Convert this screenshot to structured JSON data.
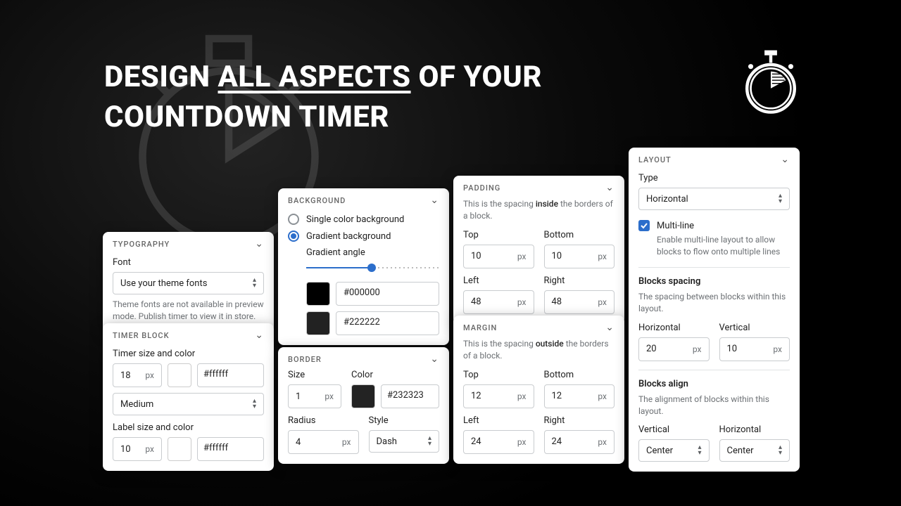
{
  "headline": {
    "pre": "DESIGN ",
    "mid": "ALL ASPECTS",
    "post": " OF YOUR",
    "line2": "COUNTDOWN TIMER"
  },
  "typography": {
    "header": "TYPOGRAPHY",
    "font_label": "Font",
    "font_value": "Use your theme fonts",
    "font_hint": "Theme fonts are not available in preview mode. Publish timer to view it in store."
  },
  "timerblock": {
    "header": "TIMER BLOCK",
    "size_color_label": "Timer size and color",
    "timer_size": "18",
    "timer_unit": "px",
    "timer_color": "#ffffff",
    "weight": "Medium",
    "label_size_color": "Label size and color",
    "label_size": "10",
    "label_unit": "px",
    "label_color": "#ffffff"
  },
  "background": {
    "header": "BACKGROUND",
    "single": "Single color background",
    "gradient": "Gradient background",
    "angle_label": "Gradient angle",
    "angle_pct": 49,
    "color1": "#000000",
    "color2": "#222222"
  },
  "border": {
    "header": "BORDER",
    "size_label": "Size",
    "color_label": "Color",
    "size": "1",
    "size_unit": "px",
    "color": "#232323",
    "radius_label": "Radius",
    "style_label": "Style",
    "radius": "4",
    "radius_unit": "px",
    "style": "Dash"
  },
  "padding": {
    "header": "PADDING",
    "desc_pre": "This is the spacing ",
    "desc_emph": "inside",
    "desc_post": " the borders of a block.",
    "top_label": "Top",
    "bottom_label": "Bottom",
    "left_label": "Left",
    "right_label": "Right",
    "top": "10",
    "bottom": "10",
    "left": "48",
    "right": "48",
    "unit": "px"
  },
  "margin": {
    "header": "MARGIN",
    "desc_pre": "This is the spacing ",
    "desc_emph": "outside",
    "desc_post": " the borders of a block.",
    "top_label": "Top",
    "bottom_label": "Bottom",
    "left_label": "Left",
    "right_label": "Right",
    "top": "12",
    "bottom": "12",
    "left": "24",
    "right": "24",
    "unit": "px"
  },
  "layout": {
    "header": "LAYOUT",
    "type_label": "Type",
    "type_value": "Horizontal",
    "multiline": "Multi-line",
    "multiline_hint": "Enable multi-line layout to allow blocks to flow onto multiple lines",
    "spacing_title": "Blocks spacing",
    "spacing_desc": "The spacing between blocks within this layout.",
    "horiz_label": "Horizontal",
    "vert_label": "Vertical",
    "horiz": "20",
    "vert": "10",
    "unit": "px",
    "align_title": "Blocks align",
    "align_desc": "The alignment of blocks within this layout.",
    "align_vert_label": "Vertical",
    "align_horiz_label": "Horizontal",
    "align_vert": "Center",
    "align_horiz": "Center"
  }
}
